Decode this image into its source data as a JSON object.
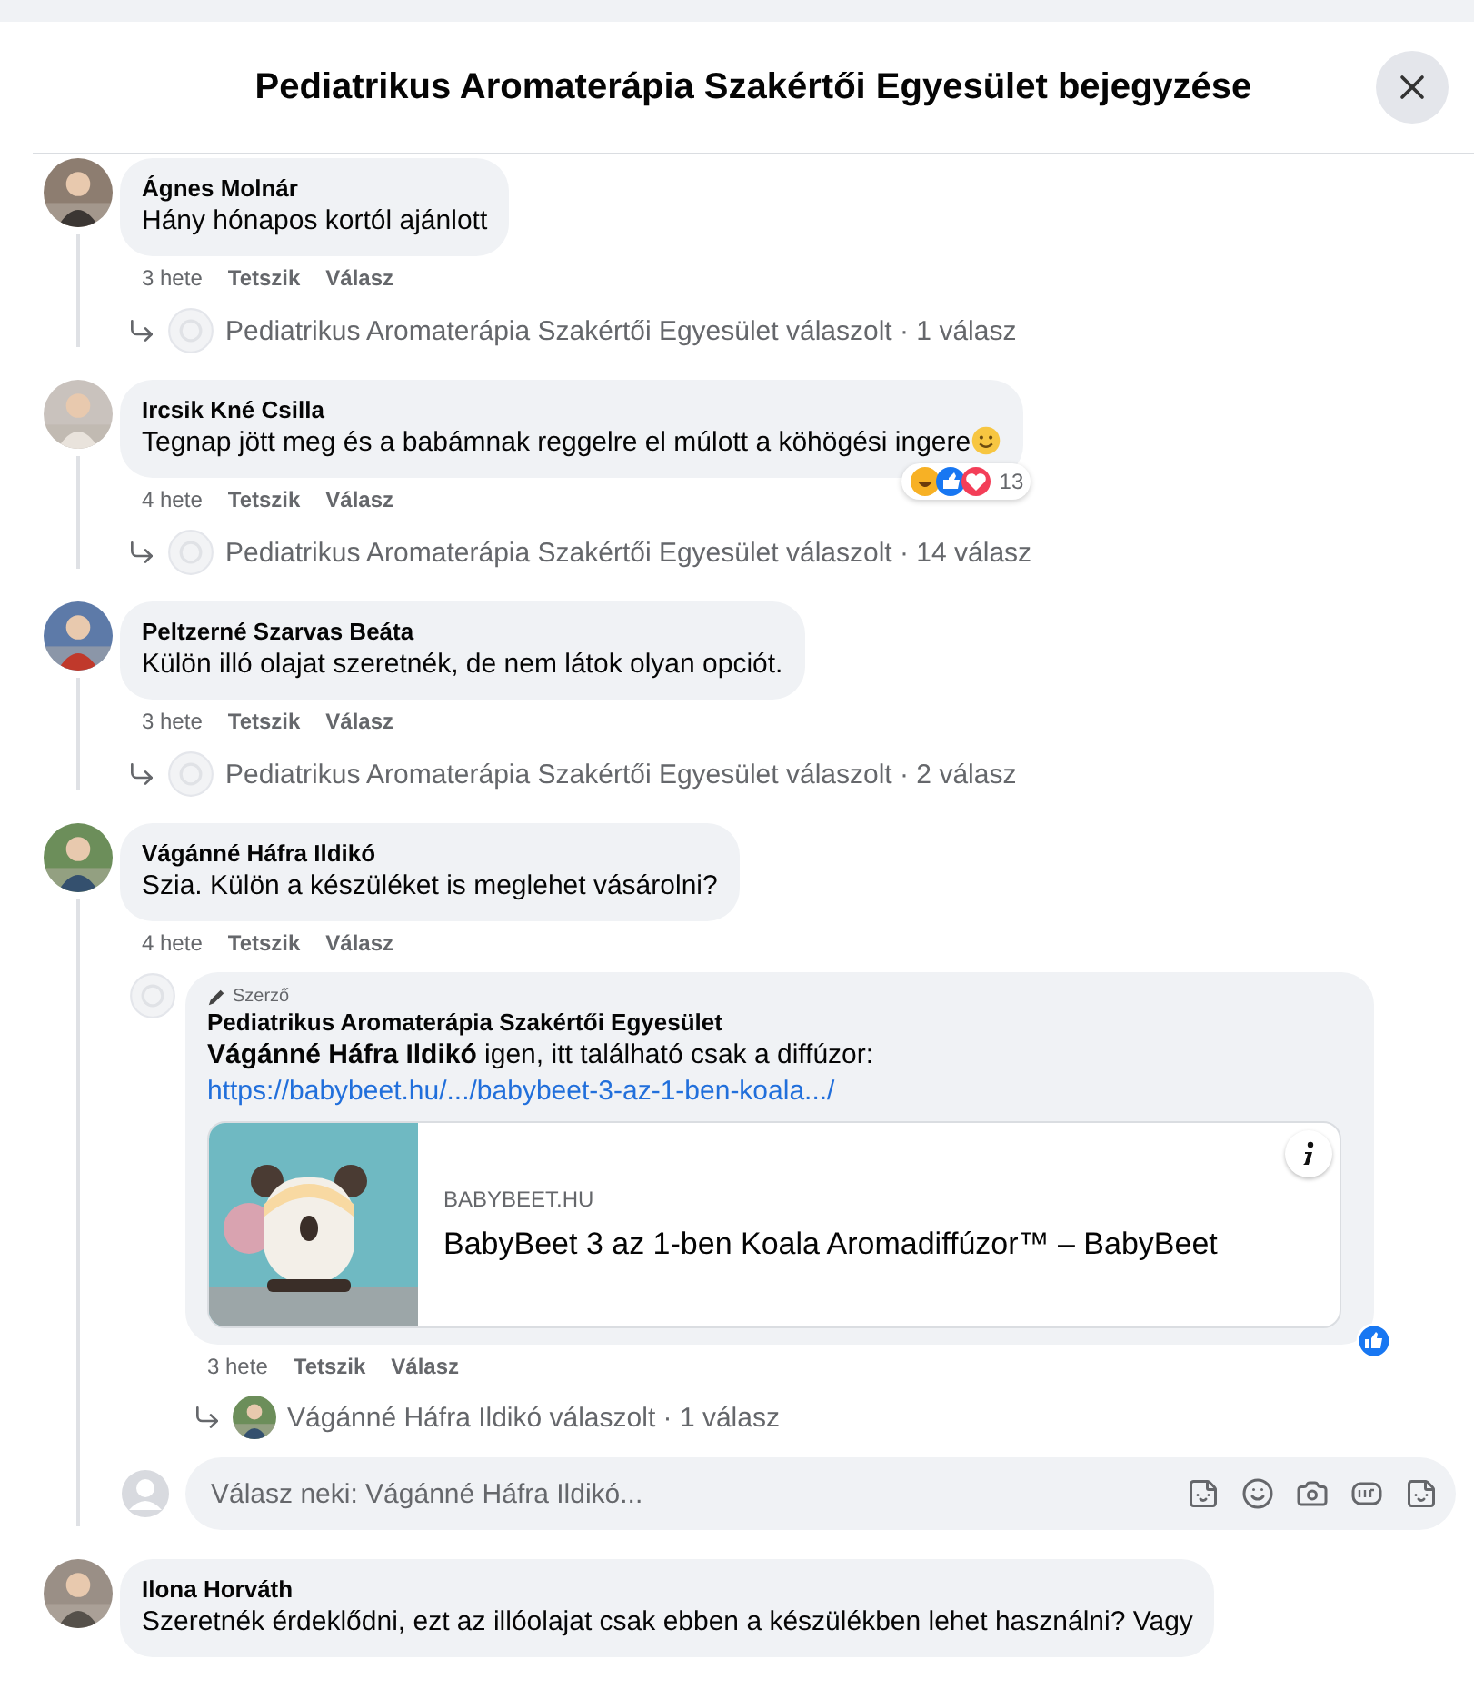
{
  "dialog": {
    "title": "Pediatrikus Aromaterápia Szakértői Egyesület bejegyzése"
  },
  "comments": [
    {
      "author": "Ágnes Molnár",
      "text": "Hány hónapos kortól ajánlott",
      "ends_with_emoji": false,
      "time": "3 hete",
      "like": "Tetszik",
      "reply": "Válasz",
      "summary": {
        "kind": "page",
        "text": "Pediatrikus Aromaterápia Szakértői Egyesület válaszolt · 1 válasz"
      }
    },
    {
      "author": "Ircsik Kné Csilla",
      "text": "Tegnap jött meg és a babámnak reggelre el múlott a köhögési ingere",
      "ends_with_emoji": true,
      "reactions": {
        "count": "13"
      },
      "time": "4 hete",
      "like": "Tetszik",
      "reply": "Válasz",
      "summary": {
        "kind": "page",
        "text": "Pediatrikus Aromaterápia Szakértői Egyesület válaszolt · 14 válasz"
      }
    },
    {
      "author": "Peltzerné Szarvas Beáta",
      "text": "Külön illó olajat szeretnék, de nem látok olyan opciót.",
      "ends_with_emoji": false,
      "time": "3 hete",
      "like": "Tetszik",
      "reply": "Válasz",
      "summary": {
        "kind": "page",
        "text": "Pediatrikus Aromaterápia Szakértői Egyesület válaszolt · 2 válasz"
      }
    },
    {
      "author": "Vágánné Háfra Ildikó",
      "text": "Szia. Külön a készüléket is meglehet vásárolni?",
      "ends_with_emoji": false,
      "time": "4 hete",
      "like": "Tetszik",
      "reply": "Válasz",
      "replies": [
        {
          "badge": "Szerző",
          "author": "Pediatrikus Aromaterápia Szakértői Egyesület",
          "text": "**Vágánné Háfra Ildikó** igen, itt található csak a diffúzor:",
          "link": "https://babybeet.hu/.../babybeet-3-az-1-ben-koala.../",
          "preview": {
            "kind": "picture",
            "domain": "BABYBEET.HU",
            "title": "BabyBeet 3 az 1-ben Koala Aromadiffúzor™ – BabyBeet"
          },
          "liked": true,
          "time": "3 hete",
          "like": "Tetszik",
          "reply": "Válasz",
          "summary": {
            "text": "Vágánné Háfra Ildikó válaszolt · 1 válasz"
          }
        }
      ],
      "reply_field": {
        "placeholder": "Válasz neki: Vágánné Háfra Ildikó..."
      }
    },
    {
      "author": "Ilona Horváth",
      "text": "Szeretnék érdeklődni, ezt az illóolajat csak ebben a készülékben lehet használni? Vagy",
      "ends_with_emoji": false
    }
  ]
}
